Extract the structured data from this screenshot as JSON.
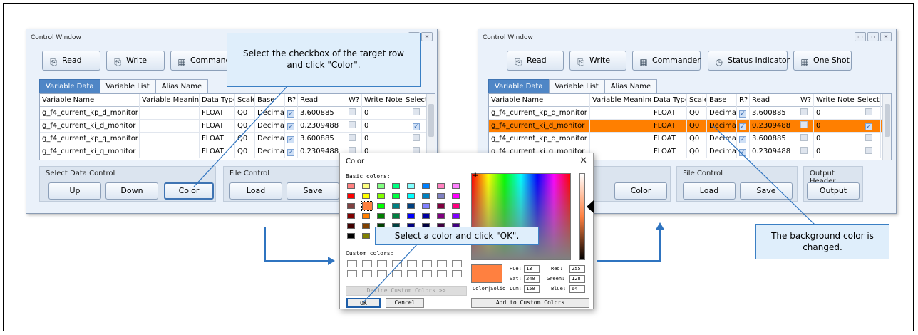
{
  "left_window": {
    "title": "Control Window",
    "toolbar": {
      "read": "Read",
      "write": "Write",
      "commander": "Commander"
    },
    "tabs": [
      "Variable Data",
      "Variable List",
      "Alias Name"
    ],
    "columns": [
      "Variable Name",
      "Variable Meaning",
      "Data Type",
      "Scale",
      "Base",
      "R?",
      "Read",
      "W?",
      "Write",
      "Note",
      "Select"
    ],
    "rows": [
      {
        "name": "g_f4_current_kp_d_monitor",
        "type": "FLOAT",
        "scale": "Q0",
        "base": "Decimal",
        "read": "3.600885",
        "write": "0"
      },
      {
        "name": "g_f4_current_ki_d_monitor",
        "type": "FLOAT",
        "scale": "Q0",
        "base": "Decimal",
        "read": "0.2309488",
        "write": "0"
      },
      {
        "name": "g_f4_current_kp_q_monitor",
        "type": "FLOAT",
        "scale": "Q0",
        "base": "Decimal",
        "read": "3.600885",
        "write": "0"
      },
      {
        "name": "g_f4_current_ki_q_monitor",
        "type": "FLOAT",
        "scale": "Q0",
        "base": "Decimal",
        "read": "0.2309488",
        "write": "0"
      }
    ],
    "select_panel": {
      "title": "Select Data Control",
      "up": "Up",
      "down": "Down",
      "color": "Color"
    },
    "file_panel": {
      "title": "File Control",
      "load": "Load",
      "save": "Save"
    }
  },
  "right_window": {
    "title": "Control Window",
    "toolbar": {
      "read": "Read",
      "write": "Write",
      "commander": "Commander",
      "status": "Status Indicator",
      "oneshot": "One Shot"
    },
    "tabs": [
      "Variable Data",
      "Variable List",
      "Alias Name"
    ],
    "columns": [
      "Variable Name",
      "Variable Meaning",
      "Data Type",
      "Scale",
      "Base",
      "R?",
      "Read",
      "W?",
      "Write",
      "Note",
      "Select"
    ],
    "rows": [
      {
        "name": "g_f4_current_kp_d_monitor",
        "type": "FLOAT",
        "scale": "Q0",
        "base": "Decimal",
        "read": "3.600885",
        "write": "0"
      },
      {
        "name": "g_f4_current_ki_d_monitor",
        "type": "FLOAT",
        "scale": "Q0",
        "base": "Decimal",
        "read": "0.2309488",
        "write": "0"
      },
      {
        "name": "g_f4_current_kp_q_monitor",
        "type": "FLOAT",
        "scale": "Q0",
        "base": "Decimal",
        "read": "3.600885",
        "write": "0"
      },
      {
        "name": "g_f4_current_ki_q_monitor",
        "type": "FLOAT",
        "scale": "Q0",
        "base": "Decimal",
        "read": "0.2309488",
        "write": "0"
      }
    ],
    "selected_row_color": "#ff7f00",
    "color_btn": "Color",
    "file_panel": {
      "title": "File Control",
      "load": "Load",
      "save": "Save"
    },
    "output_panel": {
      "title": "Output Header",
      "output": "Output"
    }
  },
  "color_dialog": {
    "title": "Color",
    "basic_colors_label": "Basic colors:",
    "custom_colors_label": "Custom colors:",
    "define_custom": "Define Custom Colors >>",
    "ok": "OK",
    "cancel": "Cancel",
    "color_solid": "Color|Solid",
    "hue_label": "Hue:",
    "hue": "13",
    "sat_label": "Sat:",
    "sat": "240",
    "lum_label": "Lum:",
    "lum": "150",
    "red_label": "Red:",
    "red": "255",
    "green_label": "Green:",
    "green": "128",
    "blue_label": "Blue:",
    "blue": "64",
    "add_custom": "Add to Custom Colors",
    "selected_color": "#ff8040"
  },
  "callouts": {
    "c1_line1": "Select the checkbox of the target row",
    "c1_line2": "and click \"Color\".",
    "c2": "Select a color and click \"OK\".",
    "c3_line1": "The background color is",
    "c3_line2": "changed."
  }
}
